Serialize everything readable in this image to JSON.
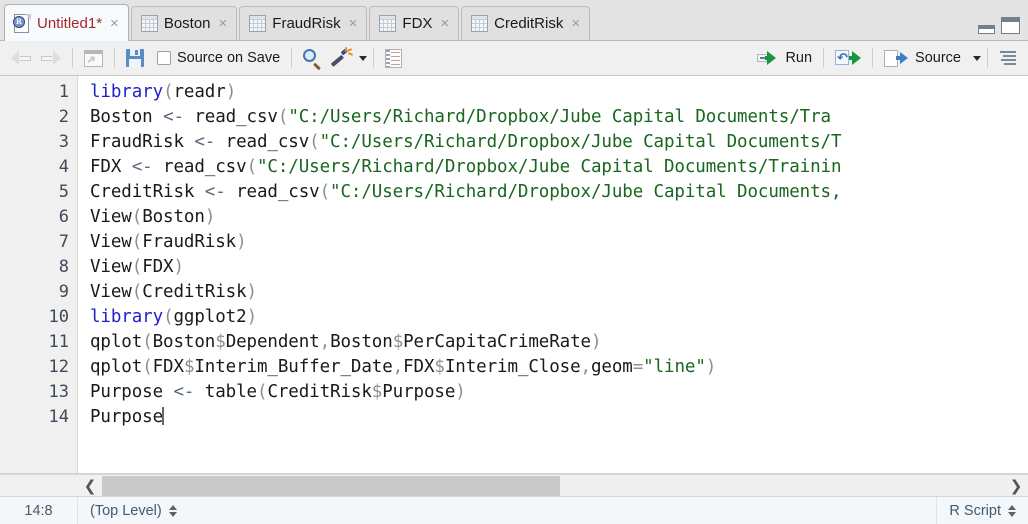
{
  "window": {
    "minimize_icon": "minimize-pane-icon",
    "maximize_icon": "maximize-pane-icon"
  },
  "tabs": [
    {
      "label": "Untitled1*",
      "icon": "r-script-icon",
      "active": true,
      "close": "×"
    },
    {
      "label": "Boston",
      "icon": "data-grid-icon",
      "active": false,
      "close": "×"
    },
    {
      "label": "FraudRisk",
      "icon": "data-grid-icon",
      "active": false,
      "close": "×"
    },
    {
      "label": "FDX",
      "icon": "data-grid-icon",
      "active": false,
      "close": "×"
    },
    {
      "label": "CreditRisk",
      "icon": "data-grid-icon",
      "active": false,
      "close": "×"
    }
  ],
  "toolbar": {
    "back_icon": "back-arrow-icon",
    "forward_icon": "forward-arrow-icon",
    "popout_icon": "show-in-new-window-icon",
    "save_icon": "save-icon",
    "source_on_save_label": "Source on Save",
    "find_icon": "find-replace-icon",
    "magic_icon": "code-tools-icon",
    "outline_icon": "document-outline-icon",
    "run_label": "Run",
    "rerun_icon": "rerun-previous-icon",
    "source_label": "Source"
  },
  "editor": {
    "line_numbers": [
      "1",
      "2",
      "3",
      "4",
      "5",
      "6",
      "7",
      "8",
      "9",
      "10",
      "11",
      "12",
      "13",
      "14"
    ],
    "lines": [
      [
        {
          "t": "library",
          "c": "kw"
        },
        {
          "t": "(",
          "c": "pun"
        },
        {
          "t": "readr",
          "c": "id"
        },
        {
          "t": ")",
          "c": "pun"
        }
      ],
      [
        {
          "t": "Boston ",
          "c": "id"
        },
        {
          "t": "<-",
          "c": "op"
        },
        {
          "t": " read_csv",
          "c": "id"
        },
        {
          "t": "(",
          "c": "pun"
        },
        {
          "t": "\"C:/Users/Richard/Dropbox/Jube Capital Documents/Tra",
          "c": "str"
        }
      ],
      [
        {
          "t": "FraudRisk ",
          "c": "id"
        },
        {
          "t": "<-",
          "c": "op"
        },
        {
          "t": " read_csv",
          "c": "id"
        },
        {
          "t": "(",
          "c": "pun"
        },
        {
          "t": "\"C:/Users/Richard/Dropbox/Jube Capital Documents/T",
          "c": "str"
        }
      ],
      [
        {
          "t": "FDX ",
          "c": "id"
        },
        {
          "t": "<-",
          "c": "op"
        },
        {
          "t": " read_csv",
          "c": "id"
        },
        {
          "t": "(",
          "c": "pun"
        },
        {
          "t": "\"C:/Users/Richard/Dropbox/Jube Capital Documents/Trainin",
          "c": "str"
        }
      ],
      [
        {
          "t": "CreditRisk ",
          "c": "id"
        },
        {
          "t": "<-",
          "c": "op"
        },
        {
          "t": " read_csv",
          "c": "id"
        },
        {
          "t": "(",
          "c": "pun"
        },
        {
          "t": "\"C:/Users/Richard/Dropbox/Jube Capital Documents,",
          "c": "str"
        }
      ],
      [
        {
          "t": "View",
          "c": "id"
        },
        {
          "t": "(",
          "c": "pun"
        },
        {
          "t": "Boston",
          "c": "id"
        },
        {
          "t": ")",
          "c": "pun"
        }
      ],
      [
        {
          "t": "View",
          "c": "id"
        },
        {
          "t": "(",
          "c": "pun"
        },
        {
          "t": "FraudRisk",
          "c": "id"
        },
        {
          "t": ")",
          "c": "pun"
        }
      ],
      [
        {
          "t": "View",
          "c": "id"
        },
        {
          "t": "(",
          "c": "pun"
        },
        {
          "t": "FDX",
          "c": "id"
        },
        {
          "t": ")",
          "c": "pun"
        }
      ],
      [
        {
          "t": "View",
          "c": "id"
        },
        {
          "t": "(",
          "c": "pun"
        },
        {
          "t": "CreditRisk",
          "c": "id"
        },
        {
          "t": ")",
          "c": "pun"
        }
      ],
      [
        {
          "t": "library",
          "c": "kw"
        },
        {
          "t": "(",
          "c": "pun"
        },
        {
          "t": "ggplot2",
          "c": "id"
        },
        {
          "t": ")",
          "c": "pun"
        }
      ],
      [
        {
          "t": "qplot",
          "c": "id"
        },
        {
          "t": "(",
          "c": "pun"
        },
        {
          "t": "Boston",
          "c": "id"
        },
        {
          "t": "$",
          "c": "pun"
        },
        {
          "t": "Dependent",
          "c": "id"
        },
        {
          "t": ",",
          "c": "pun"
        },
        {
          "t": "Boston",
          "c": "id"
        },
        {
          "t": "$",
          "c": "pun"
        },
        {
          "t": "PerCapitaCrimeRate",
          "c": "id"
        },
        {
          "t": ")",
          "c": "pun"
        }
      ],
      [
        {
          "t": "qplot",
          "c": "id"
        },
        {
          "t": "(",
          "c": "pun"
        },
        {
          "t": "FDX",
          "c": "id"
        },
        {
          "t": "$",
          "c": "pun"
        },
        {
          "t": "Interim_Buffer_Date",
          "c": "id"
        },
        {
          "t": ",",
          "c": "pun"
        },
        {
          "t": "FDX",
          "c": "id"
        },
        {
          "t": "$",
          "c": "pun"
        },
        {
          "t": "Interim_Close",
          "c": "id"
        },
        {
          "t": ",",
          "c": "pun"
        },
        {
          "t": "geom",
          "c": "id"
        },
        {
          "t": "=",
          "c": "pun"
        },
        {
          "t": "\"line\"",
          "c": "str"
        },
        {
          "t": ")",
          "c": "pun"
        }
      ],
      [
        {
          "t": "Purpose ",
          "c": "id"
        },
        {
          "t": "<-",
          "c": "op"
        },
        {
          "t": " table",
          "c": "id"
        },
        {
          "t": "(",
          "c": "pun"
        },
        {
          "t": "CreditRisk",
          "c": "id"
        },
        {
          "t": "$",
          "c": "pun"
        },
        {
          "t": "Purpose",
          "c": "id"
        },
        {
          "t": ")",
          "c": "pun"
        }
      ],
      [
        {
          "t": "Purpose",
          "c": "id"
        },
        {
          "t": "",
          "c": "caret"
        }
      ]
    ]
  },
  "scrollbar": {
    "left_arrow": "❮",
    "right_arrow": "❯"
  },
  "statusbar": {
    "cursor_position": "14:8",
    "scope": "(Top Level)",
    "file_type": "R Script"
  },
  "colors": {
    "keyword": "#2020d0",
    "string": "#19661f",
    "punctuation": "#8a8f96",
    "active_tab_text": "#a52727",
    "run_green": "#1a9641",
    "save_blue": "#5b8bc4"
  }
}
